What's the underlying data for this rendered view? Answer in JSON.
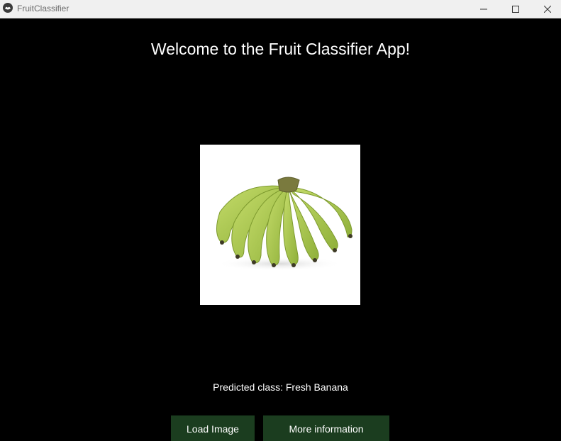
{
  "window": {
    "title": "FruitClassifier",
    "controls": {
      "minimize_icon": "minimize-icon",
      "maximize_icon": "maximize-icon",
      "close_icon": "close-icon"
    }
  },
  "main": {
    "heading": "Welcome to the Fruit Classifier App!",
    "image_icon": "banana-image",
    "prediction": "Predicted class: Fresh Banana"
  },
  "buttons": {
    "load_label": "Load Image",
    "info_label": "More information"
  },
  "colors": {
    "background": "#000000",
    "button": "#1b3d1f",
    "titlebar": "#f0f0f0",
    "banana": "#a8c84a"
  }
}
